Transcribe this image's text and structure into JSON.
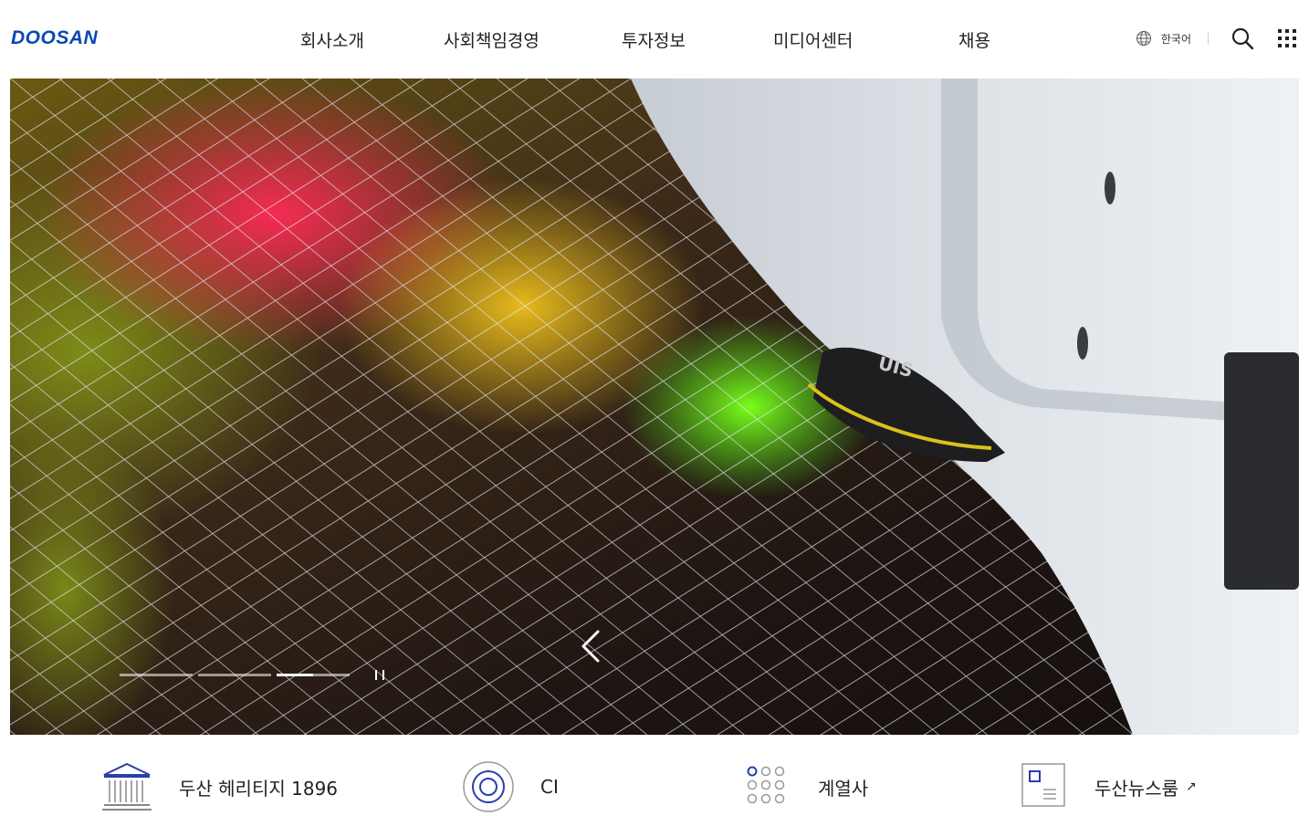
{
  "header": {
    "logo": "DOOSAN",
    "nav": [
      "회사소개",
      "사회책임경영",
      "투자정보",
      "미디어센터",
      "채용"
    ],
    "language": "한국어",
    "icons": {
      "language": "globe-icon",
      "search": "search-icon",
      "menu": "grid-menu-icon"
    }
  },
  "hero": {
    "slides_total": 3,
    "active_slide": 3,
    "active_progress": 0.5,
    "controls": {
      "prev": "chevron-left-icon",
      "pause": "pause-icon"
    }
  },
  "quick_links": [
    {
      "label": "두산 헤리티지 1896",
      "icon": "museum-icon"
    },
    {
      "label": "CI",
      "icon": "ci-circle-icon"
    },
    {
      "label": "계열사",
      "icon": "dots-grid-icon"
    },
    {
      "label": "두산뉴스룸",
      "icon": "newsroom-icon",
      "external": "↗"
    }
  ],
  "colors": {
    "brand": "#0a47b5",
    "text": "#222222",
    "icon_blue": "#2a3fa8"
  }
}
